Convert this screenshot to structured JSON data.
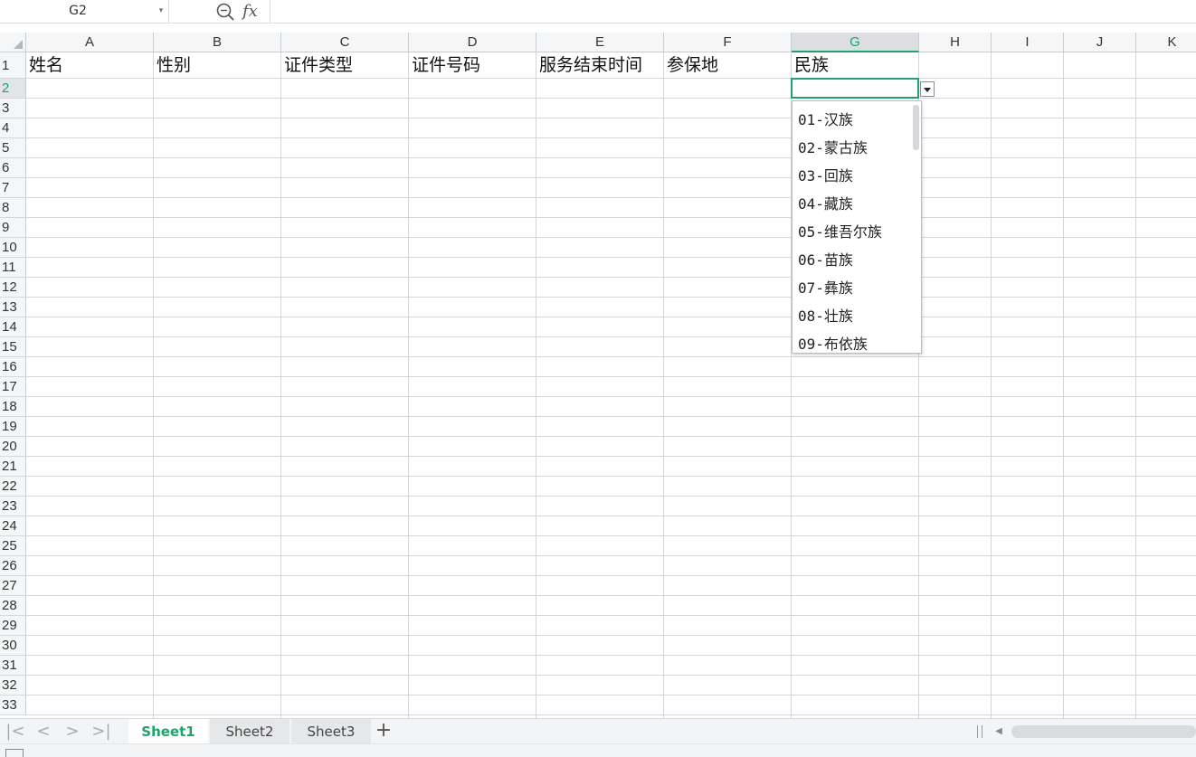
{
  "formula_bar": {
    "cell_ref": "G2",
    "fx_label": "fx",
    "formula_value": ""
  },
  "columns": [
    "A",
    "B",
    "C",
    "D",
    "E",
    "F",
    "G",
    "H",
    "I",
    "J",
    "K"
  ],
  "selected_column": "G",
  "rows": [
    "1",
    "2",
    "3",
    "4",
    "5",
    "6",
    "7",
    "8",
    "9",
    "10",
    "11",
    "12",
    "13",
    "14",
    "15",
    "16",
    "17",
    "18",
    "19",
    "20",
    "21",
    "22",
    "23",
    "24",
    "25",
    "26",
    "27",
    "28",
    "29",
    "30",
    "31",
    "32",
    "33"
  ],
  "selected_row": "2",
  "header_row": {
    "A": "姓名",
    "B": "性别",
    "C": "证件类型",
    "D": "证件号码",
    "E": "服务结束时间",
    "F": "参保地",
    "G": "民族"
  },
  "dropdown": {
    "options": [
      "01-汉族",
      "02-蒙古族",
      "03-回族",
      "04-藏族",
      "05-维吾尔族",
      "06-苗族",
      "07-彝族",
      "08-壮族",
      "09-布依族"
    ]
  },
  "sheet_tabs": [
    {
      "label": "Sheet1",
      "active": true
    },
    {
      "label": "Sheet2",
      "active": false
    },
    {
      "label": "Sheet3",
      "active": false
    }
  ],
  "colors": {
    "accent": "#1fa36a",
    "header_bg": "#f5f6f7",
    "gridline": "#d3d6da"
  }
}
